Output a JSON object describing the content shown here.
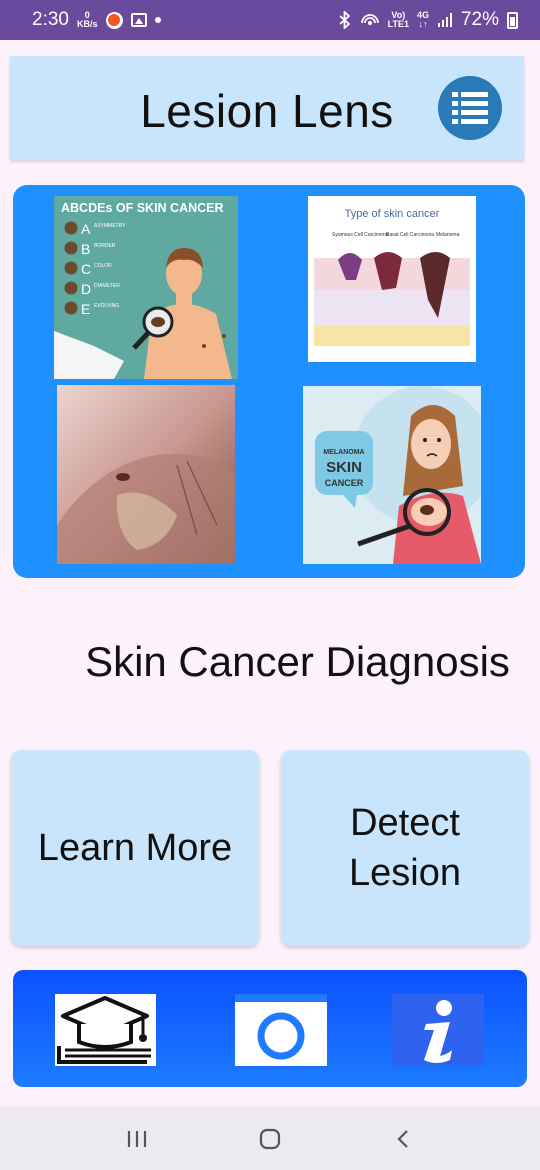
{
  "status_bar": {
    "time": "2:30",
    "net_speed_value": "0",
    "net_speed_unit": "KB/s",
    "network_top": "Vo)",
    "network_bottom": "LTE1",
    "gen": "4G",
    "battery": "72%"
  },
  "header": {
    "title": "Lesion Lens",
    "menu_icon": "list-icon"
  },
  "gallery": {
    "tiles": [
      {
        "icon": "abcde-skin-cancer-infographic",
        "title": "ABCDEs OF SKIN CANCER",
        "rows": [
          {
            "letter": "A",
            "label": "ASYMMETRY"
          },
          {
            "letter": "B",
            "label": "BORDER"
          },
          {
            "letter": "C",
            "label": "COLOR"
          },
          {
            "letter": "D",
            "label": "DIAMETER"
          },
          {
            "letter": "E",
            "label": "EVOLVING"
          }
        ]
      },
      {
        "icon": "skin-cancer-types-diagram",
        "title": "Type of skin cancer",
        "labels": [
          "Syamous Cell Carcinoma",
          "Basal Cell Carcinoma",
          "Melanoma"
        ]
      },
      {
        "icon": "shoulder-lesion-photo"
      },
      {
        "icon": "melanoma-illustration",
        "bubble": [
          "MELANOMA",
          "SKIN",
          "CANCER"
        ]
      }
    ]
  },
  "section_title": "Skin Cancer Diagnosis",
  "actions": {
    "learn_more": "Learn More",
    "detect_lesion_line1": "Detect",
    "detect_lesion_line2": "Lesion"
  },
  "bottom_nav": {
    "items": [
      "education-icon",
      "camera-icon",
      "info-icon"
    ]
  },
  "colors": {
    "status_bar": "#6a4a9c",
    "card_light_blue": "#c9e5fb",
    "panel_blue": "#1e90ff",
    "bar_blue": "#0b52ff",
    "menu_button": "#2a7ab8"
  }
}
